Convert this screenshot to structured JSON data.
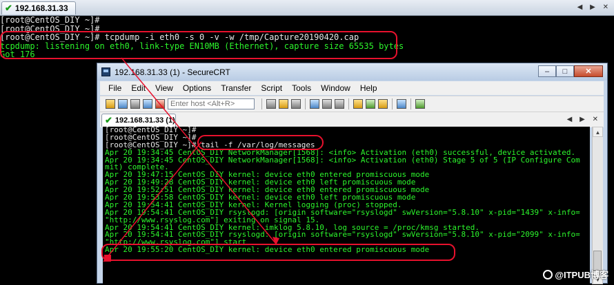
{
  "outer": {
    "tab_label": "192.168.31.33",
    "terminal_lines": [
      {
        "text": "[root@CentOS_DIY ~]#",
        "color": "white"
      },
      {
        "text": "[root@CentOS_DIY ~]#",
        "color": "white"
      },
      {
        "text": "[root@CentOS_DIY ~]# tcpdump -i eth0 -s 0 -v -w /tmp/Capture20190420.cap",
        "color": "white"
      },
      {
        "text": "tcpdump: listening on eth0, link-type EN10MB (Ethernet), capture size 65535 bytes",
        "color": "green"
      },
      {
        "text": "Got 176",
        "color": "green"
      }
    ]
  },
  "window": {
    "title": "192.168.31.33 (1) - SecureCRT",
    "menu": [
      "File",
      "Edit",
      "View",
      "Options",
      "Transfer",
      "Script",
      "Tools",
      "Window",
      "Help"
    ],
    "host_placeholder": "Enter host <Alt+R>",
    "tab_label": "192.168.31.33 (1)",
    "terminal_lines": [
      {
        "text": "[root@CentOS_DIY ~]#",
        "color": "white"
      },
      {
        "text": "[root@CentOS_DIY ~]#",
        "color": "white"
      },
      {
        "text": "[root@CentOS_DIY ~]# tail -f /var/log/messages",
        "color": "white"
      },
      {
        "text": "Apr 20 19:34:45 CentOS_DIY NetworkManager[1568]: <info> Activation (eth0) successful, device activated.",
        "color": "green"
      },
      {
        "text": "Apr 20 19:34:45 CentOS_DIY NetworkManager[1568]: <info> Activation (eth0) Stage 5 of 5 (IP Configure Com",
        "color": "green"
      },
      {
        "text": "mit) complete.",
        "color": "green"
      },
      {
        "text": "Apr 20 19:47:15 CentOS_DIY kernel: device eth0 entered promiscuous mode",
        "color": "green"
      },
      {
        "text": "Apr 20 19:49:28 CentOS_DIY kernel: device eth0 left promiscuous mode",
        "color": "green"
      },
      {
        "text": "Apr 20 19:52:51 CentOS_DIY kernel: device eth0 entered promiscuous mode",
        "color": "green"
      },
      {
        "text": "Apr 20 19:53:58 CentOS_DIY kernel: device eth0 left promiscuous mode",
        "color": "green"
      },
      {
        "text": "Apr 20 19:54:41 CentOS_DIY kernel: Kernel logging (proc) stopped.",
        "color": "green"
      },
      {
        "text": "Apr 20 19:54:41 CentOS_DIY rsyslogd: [origin software=\"rsyslogd\" swVersion=\"5.8.10\" x-pid=\"1439\" x-info=",
        "color": "green"
      },
      {
        "text": "\"http://www.rsyslog.com\"] exiting on signal 15.",
        "color": "green"
      },
      {
        "text": "Apr 20 19:54:41 CentOS_DIY kernel: imklog 5.8.10, log source = /proc/kmsg started.",
        "color": "green"
      },
      {
        "text": "Apr 20 19:54:41 CentOS_DIY rsyslogd: [origin software=\"rsyslogd\" swVersion=\"5.8.10\" x-pid=\"2099\" x-info=",
        "color": "green"
      },
      {
        "text": "\"http://www.rsyslog.com\"] start",
        "color": "green"
      },
      {
        "text": "Apr 20 19:55:20 CentOS_DIY kernel: device eth0 entered promiscuous mode",
        "color": "green"
      }
    ]
  },
  "watermark": "@ITPUB博客",
  "colors": {
    "terminal_green": "#2cf52c",
    "terminal_white": "#e8e8e8",
    "annotation_red": "#e8112d"
  }
}
